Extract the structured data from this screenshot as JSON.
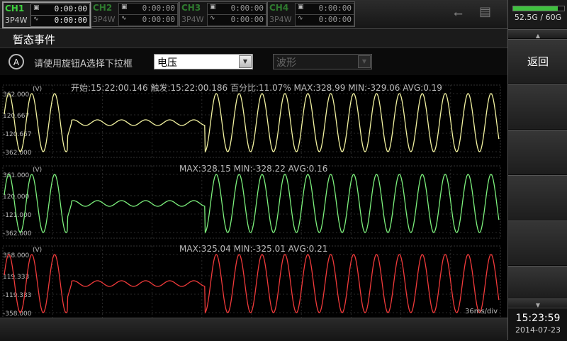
{
  "channels": [
    {
      "name": "CH1",
      "mode": "3P4W",
      "time1": "0:00:00",
      "time2": "0:00:00",
      "active": true
    },
    {
      "name": "CH2",
      "mode": "3P4W",
      "time1": "0:00:00",
      "time2": "0:00:00",
      "active": false
    },
    {
      "name": "CH3",
      "mode": "3P4W",
      "time1": "0:00:00",
      "time2": "0:00:00",
      "active": false
    },
    {
      "name": "CH4",
      "mode": "3P4W",
      "time1": "0:00:00",
      "time2": "0:00:00",
      "active": false
    }
  ],
  "storage": {
    "text": "52.5G / 60G",
    "fraction": 0.875
  },
  "page_title": "暂态事件",
  "selector": {
    "hint": "请使用旋钮A选择下拉框",
    "combo1": "电压",
    "combo2": "波形"
  },
  "softkeys": {
    "back": "返回"
  },
  "clock": {
    "time": "15:23:59",
    "date": "2014-07-23"
  },
  "charts": {
    "header": "开始:15:22:00.146  触发:15:22:00.186  百分比:11.07%  MAX:328.99  MIN:-329.06  AVG:0.19",
    "timebase": "36ms/div",
    "panels": [
      {
        "unit": "(V)",
        "stats": "MAX:328.99  MIN:-329.06  AVG:0.19",
        "ticks": [
          "362.000",
          "120.667",
          "-120.667",
          "-362.000"
        ],
        "color": "#f2f2a0"
      },
      {
        "unit": "(V)",
        "stats": "MAX:328.15  MIN:-328.22  AVG:0.16",
        "ticks": [
          "361.000",
          "120.000",
          "-121.000",
          "-362.000"
        ],
        "color": "#7cf07c"
      },
      {
        "unit": "(V)",
        "stats": "MAX:325.04  MIN:-325.01  AVG:0.21",
        "ticks": [
          "358.000",
          "119.333",
          "-119.333",
          "-358.000"
        ],
        "color": "#f03a3a"
      }
    ]
  }
}
